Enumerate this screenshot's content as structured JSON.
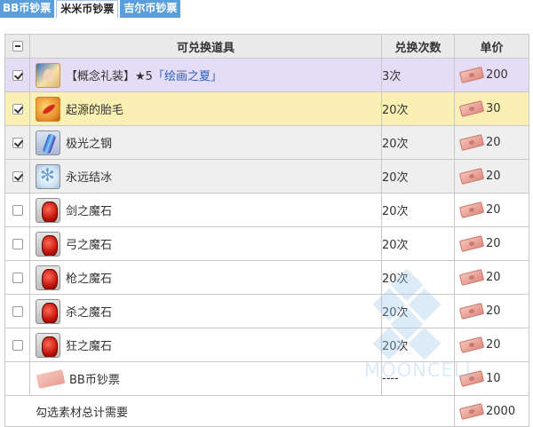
{
  "tabs": [
    {
      "label": "BB币钞票",
      "active": false
    },
    {
      "label": "米米币钞票",
      "active": true
    },
    {
      "label": "吉尔币钞票",
      "active": false
    }
  ],
  "table": {
    "headers": {
      "item": "可兑换道具",
      "count": "兑换次数",
      "price": "单价"
    },
    "rows": [
      {
        "checked": true,
        "icon": "craft-essence-icon",
        "prefix": "【概念礼装】★5",
        "link": "「绘画之夏」",
        "count": "3次",
        "price": "200",
        "style": "ce"
      },
      {
        "checked": true,
        "icon": "phoenix-feather-icon",
        "name": "起源的胎毛",
        "count": "20次",
        "price": "30",
        "style": "yellow"
      },
      {
        "checked": true,
        "icon": "aurora-steel-icon",
        "name": "极光之钢",
        "count": "20次",
        "price": "20",
        "style": "gray"
      },
      {
        "checked": true,
        "icon": "eternal-ice-icon",
        "name": "永远结冰",
        "count": "20次",
        "price": "20",
        "style": "gray"
      },
      {
        "checked": false,
        "icon": "saber-gem-icon",
        "name": "剑之魔石",
        "count": "20次",
        "price": "20",
        "style": "gray"
      },
      {
        "checked": false,
        "icon": "archer-gem-icon",
        "name": "弓之魔石",
        "count": "20次",
        "price": "20",
        "style": "gray"
      },
      {
        "checked": false,
        "icon": "lancer-gem-icon",
        "name": "枪之魔石",
        "count": "20次",
        "price": "20",
        "style": "gray"
      },
      {
        "checked": false,
        "icon": "assassin-gem-icon",
        "name": "杀之魔石",
        "count": "20次",
        "price": "20",
        "style": "gray"
      },
      {
        "checked": false,
        "icon": "berserker-gem-icon",
        "name": "狂之魔石",
        "count": "20次",
        "price": "20",
        "style": "gray"
      }
    ],
    "ticket_row": {
      "icon": "bb-ticket-icon",
      "name": "BB币钞票",
      "count": "----",
      "price": "10"
    },
    "total_row": {
      "label": "勾选素材总计需要",
      "price": "2000"
    }
  },
  "watermark": {
    "text": "MOONCELL"
  },
  "colors": {
    "tab_blue": "#5a9fdc",
    "ce_row": "#e5dcf5",
    "highlight_row": "#faf0b4",
    "link": "#2a63b6"
  }
}
